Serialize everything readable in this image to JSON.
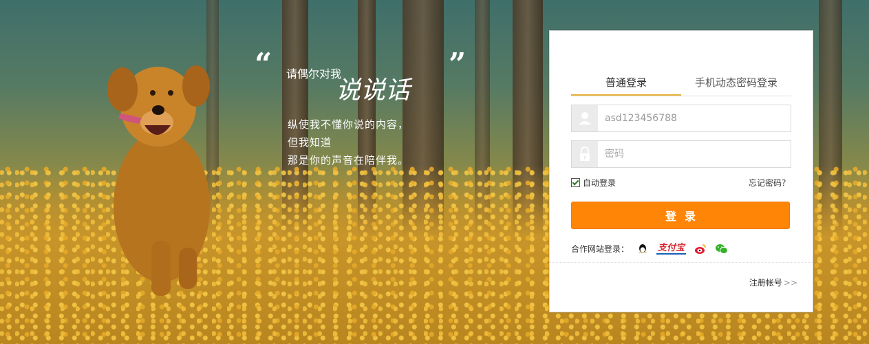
{
  "quote": {
    "open_mark": "“",
    "close_mark": "”",
    "line1": "请偶尔对我",
    "line2": "说说话",
    "body": [
      "纵使我不懂你说的内容，",
      "但我知道",
      "那是你的声音在陪伴我。"
    ]
  },
  "login": {
    "tabs": [
      "普通登录",
      "手机动态密码登录"
    ],
    "username_value": "asd123456788",
    "password_placeholder": "密码",
    "remember_label": "自动登录",
    "forgot_label": "忘记密码？",
    "submit_label": "登录",
    "partners_label": "合作网站登录：",
    "partners": {
      "alipay_text": "支付宝"
    },
    "register_label": "注册帐号",
    "register_arrow": ">>"
  },
  "colors": {
    "accent": "#ff8507",
    "tab_underline": "#e8b23a"
  },
  "icons": [
    "user-icon",
    "lock-icon",
    "qq-icon",
    "alipay-icon",
    "weibo-icon",
    "wechat-icon"
  ]
}
